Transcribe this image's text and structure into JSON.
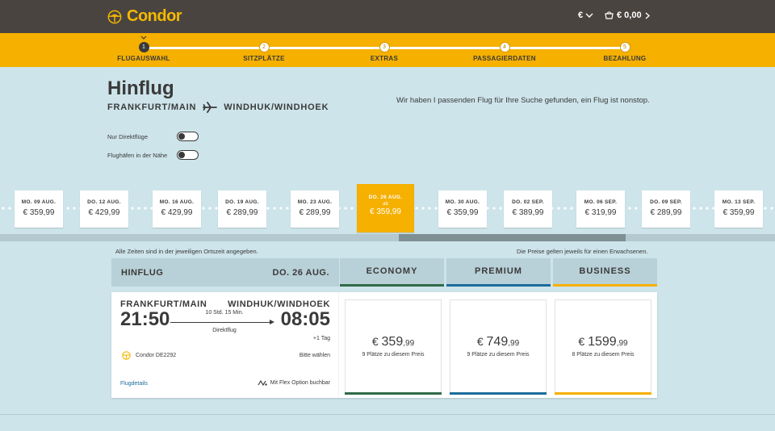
{
  "brand": {
    "name": "Condor",
    "color": "#f5b900",
    "icon": "condor-bird-icon"
  },
  "header": {
    "currency": "€",
    "cart_total": "€ 0,00"
  },
  "steps": [
    {
      "num": "1",
      "label": "FLUGAUSWAHL",
      "active": true
    },
    {
      "num": "2",
      "label": "SITZPLÄTZE",
      "active": false
    },
    {
      "num": "3",
      "label": "EXTRAS",
      "active": false
    },
    {
      "num": "4",
      "label": "PASSAGIERDATEN",
      "active": false
    },
    {
      "num": "5",
      "label": "BEZAHLUNG",
      "active": false
    }
  ],
  "page": {
    "title": "Hinflug",
    "origin": "FRANKFURT/MAIN",
    "destination": "WINDHUK/WINDHOEK",
    "info": "Wir haben I passenden Flug für Ihre Suche gefunden, ein Flug ist nonstop.",
    "filters": [
      {
        "label": "Nur Direktflüge",
        "on": false
      },
      {
        "label": "Flughäfen in der Nähe",
        "on": false
      }
    ]
  },
  "dates": [
    {
      "date": "MO. 09 AUG.",
      "price": "€ 359,99"
    },
    {
      "date": "DO. 12 AUG.",
      "price": "€ 429,99"
    },
    {
      "date": "MO. 16 AUG.",
      "price": "€ 429,99"
    },
    {
      "date": "DO. 19 AUG.",
      "price": "€ 289,99"
    },
    {
      "date": "MO. 23 AUG.",
      "price": "€ 289,99"
    },
    {
      "date": "DO. 26 AUG.",
      "price": "€ 359,99",
      "active": true,
      "prefix": "ab"
    },
    {
      "date": "MO. 30 AUG.",
      "price": "€ 359,99"
    },
    {
      "date": "DO. 02 SEP.",
      "price": "€ 389,99"
    },
    {
      "date": "MO. 06 SEP.",
      "price": "€ 319,99"
    },
    {
      "date": "DO. 09 SEP.",
      "price": "€ 289,99"
    },
    {
      "date": "MO. 13 SEP.",
      "price": "€ 359,99"
    }
  ],
  "notes": {
    "left": "Alle Zeiten sind in der jeweiligen Ortszeit angegeben.",
    "right": "Die Preise gelten jeweils für einen Erwachsenen."
  },
  "table": {
    "heading": "HINFLUG",
    "date": "DO. 26 AUG.",
    "classes": [
      {
        "name": "ECONOMY",
        "color": "#2f6b47",
        "price_main": "359",
        "price_cents": "99",
        "seats": "9 Plätze zu diesem Preis"
      },
      {
        "name": "PREMIUM",
        "color": "#1b6c9a",
        "price_main": "749",
        "price_cents": "99",
        "seats": "9 Plätze zu diesem Preis"
      },
      {
        "name": "BUSINESS",
        "color": "#f5b000",
        "price_main": "1599",
        "price_cents": "99",
        "seats": "8 Plätze zu diesem Preis"
      }
    ]
  },
  "flight": {
    "from": "FRANKFURT/MAIN",
    "to": "WINDHUK/WINDHOEK",
    "departure": "21:50",
    "arrival": "08:05",
    "duration": "10 Std. 15 Min.",
    "type": "Direktflug",
    "next_day": "+1 Tag",
    "airline": "Condor DE2292",
    "select_hint": "Bitte wählen",
    "details_link": "Flugdetails",
    "flex_note": "Mit Flex Option buchbar"
  }
}
